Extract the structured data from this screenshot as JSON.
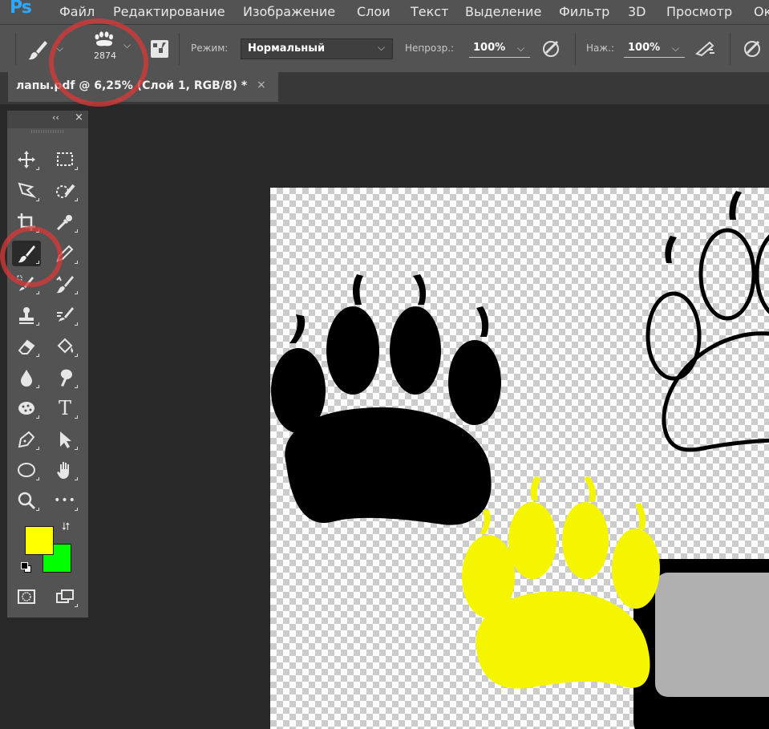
{
  "app": {
    "logo": "Ps"
  },
  "menu": [
    "Файл",
    "Редактирование",
    "Изображение",
    "Слои",
    "Текст",
    "Выделение",
    "Фильтр",
    "3D",
    "Просмотр",
    "Ок"
  ],
  "options": {
    "brush_size": "2874",
    "mode_label": "Режим:",
    "mode_value": "Нормальный",
    "opacity_label": "Непрозр.:",
    "opacity_value": "100%",
    "flow_label": "Наж.:",
    "flow_value": "100%"
  },
  "document": {
    "tab_title": "лапы.pdf @ 6,25% (Слой 1, RGB/8) *",
    "close": "×"
  },
  "toolbar": {
    "collapse": "‹‹",
    "close": "×",
    "tools": [
      "move-tool",
      "marquee-tool",
      "lasso-tool",
      "quick-selection-tool",
      "crop-tool",
      "eyedropper-tool",
      "brush-tool",
      "pencil-tool",
      "spot-healing-tool",
      "history-brush-tool",
      "clone-stamp-tool",
      "mixer-brush-tool",
      "eraser-tool",
      "paint-bucket-tool",
      "blur-tool",
      "smudge-tool",
      "sponge-tool",
      "type-tool",
      "pen-tool",
      "path-selection-tool",
      "ellipse-tool",
      "hand-tool",
      "zoom-tool",
      "more-tools"
    ],
    "active_tool": "brush-tool",
    "type_glyph": "T",
    "more_glyph": "•••"
  },
  "colors": {
    "foreground": "#ffff00",
    "background": "#00ff00",
    "accent": "#31a8ff",
    "highlight_ring": "#d63838"
  }
}
